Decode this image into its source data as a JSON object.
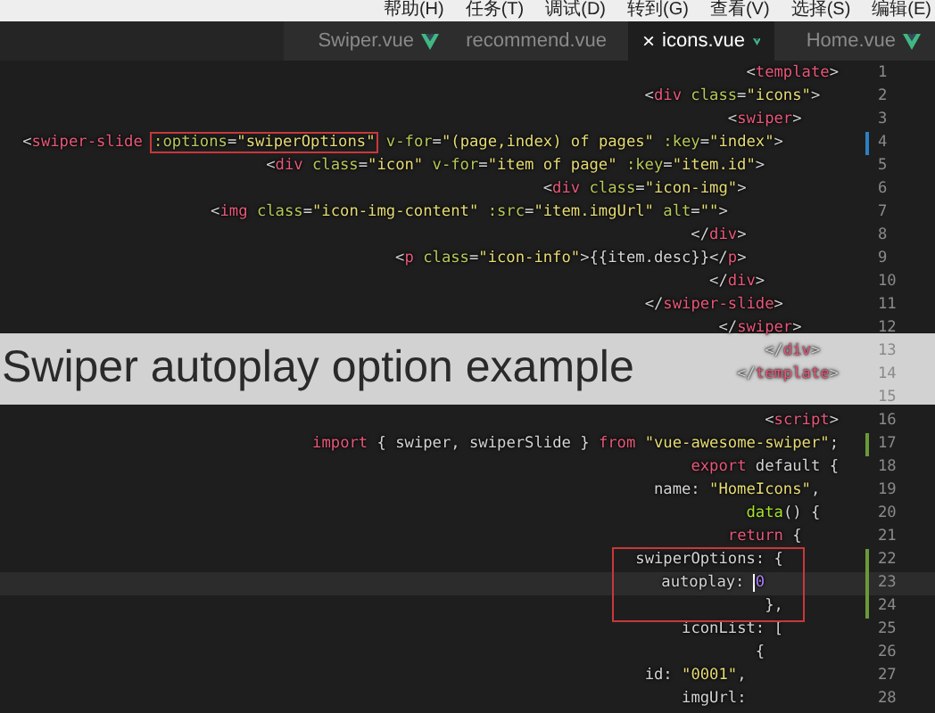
{
  "menu": [
    "帮助(H)",
    "任务(T)",
    "调试(D)",
    "转到(G)",
    "查看(V)",
    "选择(S)",
    "编辑(E)"
  ],
  "tabs": [
    {
      "label": "Swiper.vue",
      "selected": false
    },
    {
      "label": "recommend.vue",
      "selected": false
    },
    {
      "label": "icons.vue",
      "selected": true,
      "close": "×"
    },
    {
      "label": "Home.vue",
      "selected": false
    }
  ],
  "lines": [
    {
      "number": "1",
      "tokens": [
        {
          "kind": "plain",
          "text": "<"
        },
        {
          "kind": "tag",
          "text": "template"
        },
        {
          "kind": "plain",
          "text": ">"
        }
      ]
    },
    {
      "number": "2",
      "tokens": [
        {
          "kind": "plain",
          "text": "  <"
        },
        {
          "kind": "tag",
          "text": "div"
        },
        {
          "kind": "attr",
          "text": " class"
        },
        {
          "kind": "plain",
          "text": "="
        },
        {
          "kind": "string",
          "text": "\"icons\""
        },
        {
          "kind": "plain",
          "text": ">"
        }
      ]
    },
    {
      "number": "3",
      "tokens": [
        {
          "kind": "plain",
          "text": "    <"
        },
        {
          "kind": "tag",
          "text": "swiper"
        },
        {
          "kind": "plain",
          "text": ">"
        }
      ]
    },
    {
      "number": "4",
      "color": "#2f7fc1",
      "tokens": [
        {
          "kind": "plain",
          "text": "      <"
        },
        {
          "kind": "tag",
          "text": "swiper-slide "
        },
        {
          "kind": "attr",
          "text": ":options",
          "boxed": true
        },
        {
          "kind": "plain",
          "text": "=",
          "boxed": true
        },
        {
          "kind": "string",
          "text": "\"swiperOptions\"",
          "boxed": true
        },
        {
          "kind": "attr",
          "text": " v-for"
        },
        {
          "kind": "plain",
          "text": "="
        },
        {
          "kind": "string",
          "text": "\"(page,index) of pages\""
        },
        {
          "kind": "attr",
          "text": " :key"
        },
        {
          "kind": "plain",
          "text": "="
        },
        {
          "kind": "string",
          "text": "\"index\""
        },
        {
          "kind": "plain",
          "text": ">"
        }
      ]
    },
    {
      "number": "5",
      "tokens": [
        {
          "kind": "plain",
          "text": "        <"
        },
        {
          "kind": "tag",
          "text": "div"
        },
        {
          "kind": "attr",
          "text": " class"
        },
        {
          "kind": "plain",
          "text": "="
        },
        {
          "kind": "string",
          "text": "\"icon\""
        },
        {
          "kind": "attr",
          "text": " v-for"
        },
        {
          "kind": "plain",
          "text": "="
        },
        {
          "kind": "string",
          "text": "\"item of page\""
        },
        {
          "kind": "attr",
          "text": " :key"
        },
        {
          "kind": "plain",
          "text": "="
        },
        {
          "kind": "string",
          "text": "\"item.id\""
        },
        {
          "kind": "plain",
          "text": ">"
        }
      ]
    },
    {
      "number": "6",
      "tokens": [
        {
          "kind": "plain",
          "text": "          <"
        },
        {
          "kind": "tag",
          "text": "div"
        },
        {
          "kind": "attr",
          "text": " class"
        },
        {
          "kind": "plain",
          "text": "="
        },
        {
          "kind": "string",
          "text": "\"icon-img\""
        },
        {
          "kind": "plain",
          "text": ">"
        }
      ]
    },
    {
      "number": "7",
      "tokens": [
        {
          "kind": "plain",
          "text": "            <"
        },
        {
          "kind": "tag",
          "text": "img"
        },
        {
          "kind": "attr",
          "text": " class"
        },
        {
          "kind": "plain",
          "text": "="
        },
        {
          "kind": "string",
          "text": "\"icon-img-content\""
        },
        {
          "kind": "attr",
          "text": " :src"
        },
        {
          "kind": "plain",
          "text": "="
        },
        {
          "kind": "string",
          "text": "\"item.imgUrl\""
        },
        {
          "kind": "attr",
          "text": " alt"
        },
        {
          "kind": "plain",
          "text": "="
        },
        {
          "kind": "string",
          "text": "\"\""
        },
        {
          "kind": "plain",
          "text": ">"
        }
      ]
    },
    {
      "number": "8",
      "tokens": [
        {
          "kind": "plain",
          "text": "          </"
        },
        {
          "kind": "tag",
          "text": "div"
        },
        {
          "kind": "plain",
          "text": ">"
        }
      ]
    },
    {
      "number": "9",
      "tokens": [
        {
          "kind": "plain",
          "text": "          <"
        },
        {
          "kind": "tag",
          "text": "p"
        },
        {
          "kind": "attr",
          "text": " class"
        },
        {
          "kind": "plain",
          "text": "="
        },
        {
          "kind": "string",
          "text": "\"icon-info\""
        },
        {
          "kind": "plain",
          "text": ">{{item.desc}}</"
        },
        {
          "kind": "tag",
          "text": "p"
        },
        {
          "kind": "plain",
          "text": ">"
        }
      ]
    },
    {
      "number": "10",
      "tokens": [
        {
          "kind": "plain",
          "text": "        </"
        },
        {
          "kind": "tag",
          "text": "div"
        },
        {
          "kind": "plain",
          "text": ">"
        }
      ]
    },
    {
      "number": "11",
      "tokens": [
        {
          "kind": "plain",
          "text": "      </"
        },
        {
          "kind": "tag",
          "text": "swiper-slide"
        },
        {
          "kind": "plain",
          "text": ">"
        }
      ]
    },
    {
      "number": "12",
      "tokens": [
        {
          "kind": "plain",
          "text": "    </"
        },
        {
          "kind": "tag",
          "text": "swiper"
        },
        {
          "kind": "plain",
          "text": ">"
        }
      ]
    },
    {
      "number": "13",
      "tokens": [
        {
          "kind": "plain",
          "text": "  </"
        },
        {
          "kind": "tag",
          "text": "div"
        },
        {
          "kind": "plain",
          "text": ">"
        }
      ]
    },
    {
      "number": "14",
      "tokens": [
        {
          "kind": "plain",
          "text": "</"
        },
        {
          "kind": "tag",
          "text": "template"
        },
        {
          "kind": "plain",
          "text": ">"
        }
      ]
    },
    {
      "number": "15"
    },
    {
      "number": "16",
      "tokens": [
        {
          "kind": "plain",
          "text": "<"
        },
        {
          "kind": "tag",
          "text": "script"
        },
        {
          "kind": "plain",
          "text": ">"
        }
      ]
    },
    {
      "number": "17",
      "color": "#6a9a3a",
      "tokens": [
        {
          "kind": "keyword",
          "text": "import"
        },
        {
          "kind": "plain",
          "text": " { swiper, swiperSlide } "
        },
        {
          "kind": "keyword",
          "text": "from"
        },
        {
          "kind": "string",
          "text": " \"vue-awesome-swiper\""
        },
        {
          "kind": "plain",
          "text": ";"
        }
      ]
    },
    {
      "number": "18",
      "tokens": [
        {
          "kind": "keyword",
          "text": "export"
        },
        {
          "kind": "plain",
          "text": " default {"
        }
      ]
    },
    {
      "number": "19",
      "tokens": [
        {
          "kind": "plain",
          "text": "  name: "
        },
        {
          "kind": "string",
          "text": "\"HomeIcons\""
        },
        {
          "kind": "plain",
          "text": ","
        }
      ]
    },
    {
      "number": "20",
      "tokens": [
        {
          "kind": "function",
          "text": "  data"
        },
        {
          "kind": "plain",
          "text": "() {"
        }
      ]
    },
    {
      "number": "21",
      "tokens": [
        {
          "kind": "keyword",
          "text": "    return"
        },
        {
          "kind": "plain",
          "text": " {"
        }
      ]
    },
    {
      "number": "22",
      "color": "#6a9a3a",
      "boxed": true,
      "tokens": [
        {
          "kind": "plain",
          "text": "      swiperOptions: {"
        }
      ]
    },
    {
      "number": "23",
      "color": "#6a9a3a",
      "boxed": true,
      "current": true,
      "tokens": [
        {
          "kind": "plain",
          "text": "        autoplay: "
        },
        {
          "kind": "number",
          "text": "0",
          "cursor": true
        }
      ]
    },
    {
      "number": "24",
      "color": "#6a9a3a",
      "boxed": true,
      "tokens": [
        {
          "kind": "plain",
          "text": "      },"
        }
      ]
    },
    {
      "number": "25",
      "tokens": [
        {
          "kind": "plain",
          "text": "      iconList: ["
        }
      ]
    },
    {
      "number": "26",
      "tokens": [
        {
          "kind": "plain",
          "text": "        {"
        }
      ]
    },
    {
      "number": "27",
      "tokens": [
        {
          "kind": "plain",
          "text": "          id: "
        },
        {
          "kind": "string",
          "text": "\"0001\""
        },
        {
          "kind": "plain",
          "text": ","
        }
      ]
    },
    {
      "number": "28",
      "tokens": [
        {
          "kind": "plain",
          "text": "          imgUrl:"
        }
      ]
    }
  ],
  "caption": "Swiper autoplay option example"
}
